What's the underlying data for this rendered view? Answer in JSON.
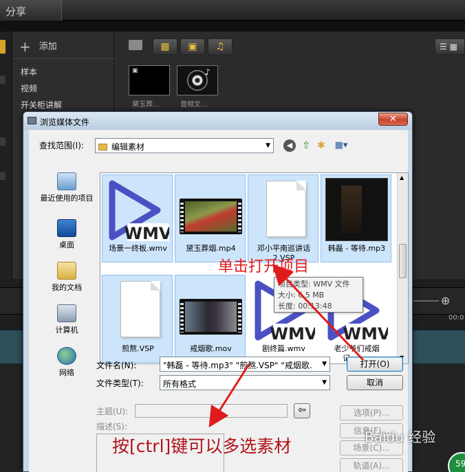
{
  "app": {
    "share_tab": "分享",
    "add_label": "添加",
    "left_items": [
      "样本",
      "视频",
      "开关柜讲解"
    ],
    "thumbs": [
      "黛玉葬...",
      "音频文..."
    ],
    "timeline_time": "00:0",
    "badge": "59"
  },
  "dialog": {
    "title": "浏览媒体文件",
    "close": "✕",
    "look_in_label": "查找范围(I):",
    "look_in_value": "编辑素材",
    "places": [
      {
        "label": "最近使用的项目",
        "icon": "recent-items-icon"
      },
      {
        "label": "桌面",
        "icon": "desktop-icon"
      },
      {
        "label": "我的文档",
        "icon": "my-documents-icon"
      },
      {
        "label": "计算机",
        "icon": "computer-icon"
      },
      {
        "label": "网络",
        "icon": "network-icon"
      }
    ],
    "files": [
      {
        "name": "场景一终板.wmv",
        "type": "wmv",
        "selected": true
      },
      {
        "name": "黛玉葬烟.mp4",
        "type": "video",
        "selected": true
      },
      {
        "name": "邓小平南巡讲话2.VSP",
        "type": "doc",
        "selected": true
      },
      {
        "name": "韩磊 - 等待.mp3",
        "type": "album",
        "selected": true
      },
      {
        "name": "煎熬.VSP",
        "type": "doc",
        "selected": true
      },
      {
        "name": "戒烟歌.mov",
        "type": "video2",
        "selected": true
      },
      {
        "name": "剧终篇.wmv",
        "type": "wmv",
        "selected": false
      },
      {
        "name": "老少爷们戒烟记.wmv",
        "type": "wmv",
        "selected": false
      }
    ],
    "wmv_text": "WMV",
    "tooltip": {
      "type": "项目类型: WMV 文件",
      "size": "大小: 6.5 MB",
      "length": "长度: 00:13:48"
    },
    "filename_label": "文件名(N):",
    "filename_value": "\"韩磊 - 等待.mp3\" \"煎熬.VSP\" \"戒烟歌.",
    "filetype_label": "文件类型(T):",
    "filetype_value": "所有格式",
    "open_button": "打开(O)",
    "cancel_button": "取消",
    "subject_label": "主题(U):",
    "desc_label": "描述(S):",
    "options_button": "选项(P)...",
    "info_button": "信息(F)...",
    "scene_button": "场景(C)...",
    "track_button": "轨道(A)..."
  },
  "annotations": {
    "click_open": "单击打开项目",
    "multi_select": "按[ctrl]键可以多选素材",
    "watermark": "Baidu 经验"
  }
}
